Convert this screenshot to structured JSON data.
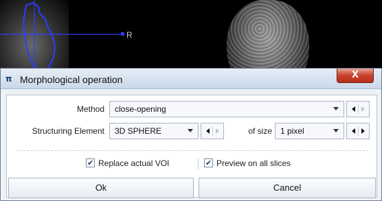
{
  "background": {
    "orientation_label": "R"
  },
  "dialog": {
    "title": "Morphological operation",
    "title_icon": "pmod-logo-icon",
    "close_label": "X",
    "method": {
      "label": "Method",
      "value": "close-opening"
    },
    "structuring_element": {
      "label": "Structuring Element",
      "value": "3D SPHERE",
      "size_label": "of size",
      "size_value": "1 pixel"
    },
    "replace_voi": {
      "label": "Replace actual VOI",
      "checked": true
    },
    "preview_all": {
      "label": "Preview on all slices",
      "checked": true
    },
    "ok_label": "Ok",
    "cancel_label": "Cancel"
  }
}
